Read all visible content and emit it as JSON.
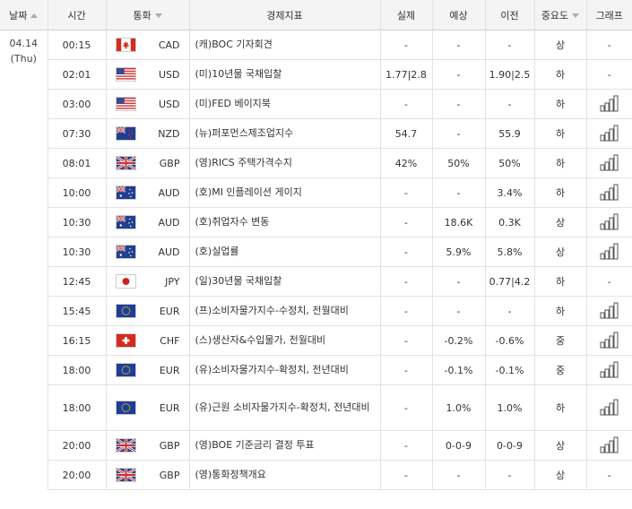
{
  "header": {
    "date": "날짜",
    "time": "시간",
    "currency": "통화",
    "indicator": "경제지표",
    "actual": "실제",
    "forecast": "예상",
    "previous": "이전",
    "importance": "중요도",
    "graph": "그래프"
  },
  "date_group": {
    "date": "04.14",
    "weekday": "(Thu)"
  },
  "rows": [
    {
      "time": "00:15",
      "flag": "CA",
      "currency": "CAD",
      "indicator": "(캐)BOC 기자회견",
      "actual": "-",
      "forecast": "-",
      "previous": "-",
      "importance": "상",
      "graph": "-"
    },
    {
      "time": "02:01",
      "flag": "US",
      "currency": "USD",
      "indicator": "(미)10년물 국채입찰",
      "actual": "1.77|2.8",
      "forecast": "-",
      "previous": "1.90|2.5",
      "importance": "하",
      "graph": "-"
    },
    {
      "time": "03:00",
      "flag": "US",
      "currency": "USD",
      "indicator": "(미)FED 베이지북",
      "actual": "-",
      "forecast": "-",
      "previous": "-",
      "importance": "하",
      "graph": "chart-icon"
    },
    {
      "time": "07:30",
      "flag": "NZ",
      "currency": "NZD",
      "indicator": "(뉴)퍼포먼스제조업지수",
      "actual": "54.7",
      "forecast": "-",
      "previous": "55.9",
      "importance": "하",
      "graph": "chart-icon"
    },
    {
      "time": "08:01",
      "flag": "GB",
      "currency": "GBP",
      "indicator": "(영)RICS 주택가격수지",
      "actual": "42%",
      "forecast": "50%",
      "previous": "50%",
      "importance": "하",
      "graph": "chart-icon"
    },
    {
      "time": "10:00",
      "flag": "AU",
      "currency": "AUD",
      "indicator": "(호)MI 인플레이션 게이지",
      "actual": "-",
      "forecast": "-",
      "previous": "3.4%",
      "importance": "하",
      "graph": "chart-icon"
    },
    {
      "time": "10:30",
      "flag": "AU",
      "currency": "AUD",
      "indicator": "(호)취업자수 변동",
      "actual": "-",
      "forecast": "18.6K",
      "previous": "0.3K",
      "importance": "상",
      "graph": "chart-icon"
    },
    {
      "time": "10:30",
      "flag": "AU",
      "currency": "AUD",
      "indicator": "(호)실업률",
      "actual": "-",
      "forecast": "5.9%",
      "previous": "5.8%",
      "importance": "상",
      "graph": "chart-icon"
    },
    {
      "time": "12:45",
      "flag": "JP",
      "currency": "JPY",
      "indicator": "(일)30년물 국채입찰",
      "actual": "-",
      "forecast": "-",
      "previous": "0.77|4.2",
      "importance": "하",
      "graph": "-"
    },
    {
      "time": "15:45",
      "flag": "EU",
      "currency": "EUR",
      "indicator": "(프)소비자물가지수-수정치, 전월대비",
      "actual": "-",
      "forecast": "-",
      "previous": "-",
      "importance": "하",
      "graph": "chart-icon"
    },
    {
      "time": "16:15",
      "flag": "CH",
      "currency": "CHF",
      "indicator": "(스)생산자&수입물가, 전월대비",
      "actual": "-",
      "forecast": "-0.2%",
      "previous": "-0.6%",
      "importance": "중",
      "graph": "chart-icon"
    },
    {
      "time": "18:00",
      "flag": "EU",
      "currency": "EUR",
      "indicator": "(유)소비자물가지수-확정치, 전년대비",
      "actual": "-",
      "forecast": "-0.1%",
      "previous": "-0.1%",
      "importance": "중",
      "graph": "chart-icon"
    },
    {
      "time": "18:00",
      "flag": "EU",
      "currency": "EUR",
      "indicator": "(유)근원 소비자물가지수-확정치, 전년대비",
      "actual": "-",
      "forecast": "1.0%",
      "previous": "1.0%",
      "importance": "하",
      "graph": "chart-icon",
      "tall": true
    },
    {
      "time": "20:00",
      "flag": "GB",
      "currency": "GBP",
      "indicator": "(영)BOE 기준금리 결정 투표",
      "actual": "-",
      "forecast": "0-0-9",
      "previous": "0-0-9",
      "importance": "상",
      "graph": "chart-icon"
    },
    {
      "time": "20:00",
      "flag": "GB",
      "currency": "GBP",
      "indicator": "(영)통화정책개요",
      "actual": "-",
      "forecast": "-",
      "previous": "-",
      "importance": "상",
      "graph": "-"
    }
  ]
}
